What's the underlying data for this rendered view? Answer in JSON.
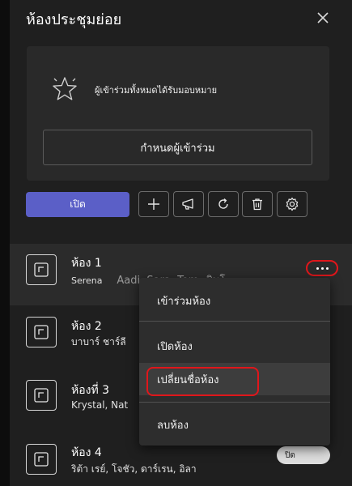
{
  "header": {
    "title": "ห้องประชุมย่อย"
  },
  "assign": {
    "text": "ผู้เข้าร่วมทั้งหมดได้รับมอบหมาย",
    "button_label": "กำหนดผู้เข้าร่วม"
  },
  "toolbar": {
    "open_label": "เปิด",
    "icons": [
      "add-icon",
      "announce-icon",
      "recreate-icon",
      "delete-icon",
      "settings-icon"
    ]
  },
  "rooms": [
    {
      "name": "ห้อง 1",
      "members_primary": "Serena",
      "members_rest": "Aadi, Sara, Tom, ชินโ"
    },
    {
      "name": "ห้อง 2",
      "members_primary": "บาบาร์ ชาร์ลี"
    },
    {
      "name": "ห้องที่ 3",
      "members_primary": "Krystal, Nat"
    },
    {
      "name": "ห้อง 4",
      "members_primary": "ริต้า เรย์, โจชัว, ดาร์เรน, อิลา",
      "status": "ปิด"
    }
  ],
  "context_menu": {
    "items": [
      "เข้าร่วมห้อง",
      "เปิดห้อง",
      "เปลี่ยนชื่อห้อง",
      "ลบห้อง"
    ]
  },
  "colors": {
    "accent": "#5b5fc7",
    "highlight_ring": "#e0161b"
  }
}
